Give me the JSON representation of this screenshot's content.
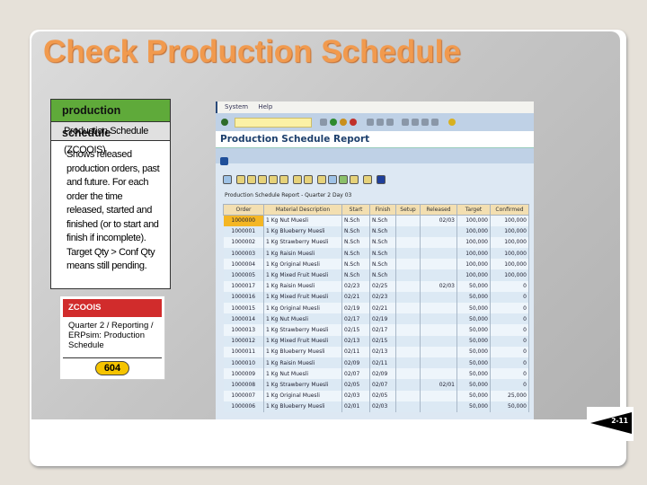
{
  "slide": {
    "title": "Check Production Schedule",
    "page_badge": "2-11"
  },
  "info_card": {
    "header": "production schedule",
    "subheader": "Production Schedule (ZCOOIS)",
    "body": "Shows released production orders, past and future. For each order the time released, started and finished (or to start and finish if incomplete). Target Qty > Conf Qty means still pending."
  },
  "tcode_card": {
    "header": "ZCOOIS",
    "path": "Quarter 2 / Reporting / ERPsim: Production Schedule",
    "number": "604"
  },
  "sap": {
    "menu": [
      "System",
      "Help"
    ],
    "screen_title": "Production Schedule Report",
    "report_title": "Production Schedule Report - Quarter 2 Day 03",
    "columns": [
      "Order",
      "Material Description",
      "Start",
      "Finish",
      "Setup",
      "Released",
      "Target",
      "Confirmed"
    ],
    "rows": [
      [
        "1000000",
        "1 Kg Nut Muesli",
        "N.Sch",
        "N.Sch",
        "",
        "02/03",
        "100,000",
        "100,000"
      ],
      [
        "1000001",
        "1 Kg Blueberry Muesli",
        "N.Sch",
        "N.Sch",
        "",
        "",
        "100,000",
        "100,000"
      ],
      [
        "1000002",
        "1 Kg Strawberry Muesli",
        "N.Sch",
        "N.Sch",
        "",
        "",
        "100,000",
        "100,000"
      ],
      [
        "1000003",
        "1 Kg Raisin Muesli",
        "N.Sch",
        "N.Sch",
        "",
        "",
        "100,000",
        "100,000"
      ],
      [
        "1000004",
        "1 Kg Original Muesli",
        "N.Sch",
        "N.Sch",
        "",
        "",
        "100,000",
        "100,000"
      ],
      [
        "1000005",
        "1 Kg Mixed Fruit Muesli",
        "N.Sch",
        "N.Sch",
        "",
        "",
        "100,000",
        "100,000"
      ],
      [
        "1000017",
        "1 Kg Raisin Muesli",
        "02/23",
        "02/25",
        "",
        "02/03",
        "50,000",
        "0"
      ],
      [
        "1000016",
        "1 Kg Mixed Fruit Muesli",
        "02/21",
        "02/23",
        "",
        "",
        "50,000",
        "0"
      ],
      [
        "1000015",
        "1 Kg Original Muesli",
        "02/19",
        "02/21",
        "",
        "",
        "50,000",
        "0"
      ],
      [
        "1000014",
        "1 Kg Nut Muesli",
        "02/17",
        "02/19",
        "",
        "",
        "50,000",
        "0"
      ],
      [
        "1000013",
        "1 Kg Strawberry Muesli",
        "02/15",
        "02/17",
        "",
        "",
        "50,000",
        "0"
      ],
      [
        "1000012",
        "1 Kg Mixed Fruit Muesli",
        "02/13",
        "02/15",
        "",
        "",
        "50,000",
        "0"
      ],
      [
        "1000011",
        "1 Kg Blueberry Muesli",
        "02/11",
        "02/13",
        "",
        "",
        "50,000",
        "0"
      ],
      [
        "1000010",
        "1 Kg Raisin Muesli",
        "02/09",
        "02/11",
        "",
        "",
        "50,000",
        "0"
      ],
      [
        "1000009",
        "1 Kg Nut Muesli",
        "02/07",
        "02/09",
        "",
        "",
        "50,000",
        "0"
      ],
      [
        "1000008",
        "1 Kg Strawberry Muesli",
        "02/05",
        "02/07",
        "",
        "02/01",
        "50,000",
        "0"
      ],
      [
        "1000007",
        "1 Kg Original Muesli",
        "02/03",
        "02/05",
        "",
        "",
        "50,000",
        "25,000"
      ],
      [
        "1000006",
        "1 Kg Blueberry Muesli",
        "02/01",
        "02/03",
        "",
        "",
        "50,000",
        "50,000"
      ]
    ]
  }
}
